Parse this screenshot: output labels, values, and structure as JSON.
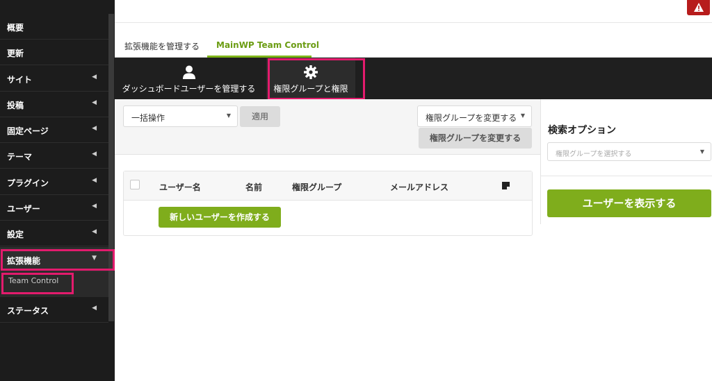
{
  "sidebar": {
    "items": [
      {
        "label": "概要",
        "has_caret": false
      },
      {
        "label": "更新",
        "has_caret": false
      },
      {
        "label": "サイト",
        "has_caret": true
      },
      {
        "label": "投稿",
        "has_caret": true
      },
      {
        "label": "固定ページ",
        "has_caret": true
      },
      {
        "label": "テーマ",
        "has_caret": true
      },
      {
        "label": "プラグイン",
        "has_caret": true
      },
      {
        "label": "ユーザー",
        "has_caret": true
      },
      {
        "label": "設定",
        "has_caret": true
      },
      {
        "label": "拡張機能",
        "has_caret": true,
        "expanded": true
      },
      {
        "label": "ステータス",
        "has_caret": true
      }
    ],
    "submenu": {
      "label": "Team Control"
    },
    "caret_glyph": "◀",
    "caret_down_glyph": "▼"
  },
  "topbar": {
    "alert_icon": "warning-icon",
    "alert_glyph": "!"
  },
  "tabs": [
    {
      "label": "拡張機能を管理する",
      "active": false
    },
    {
      "label": "MainWP Team Control",
      "active": true
    }
  ],
  "subnav": [
    {
      "label": "ダッシュボードユーザーを管理する",
      "icon": "user-icon"
    },
    {
      "label": "権限グループと権限",
      "icon": "gear-icon",
      "active": true
    }
  ],
  "toolbar": {
    "bulk_select": "一括操作",
    "apply_button": "適用",
    "group_select": "権限グループを変更する",
    "change_group_button": "権限グループを変更する"
  },
  "table": {
    "headers": [
      "ユーザー名",
      "名前",
      "権限グループ",
      "メールアドレス"
    ],
    "new_user_button": "新しいユーザーを作成する"
  },
  "search_panel": {
    "title": "検索オプション",
    "select_placeholder": "権限グループを選択する",
    "show_users_button": "ユーザーを表示する"
  },
  "colors": {
    "accent_green": "#7fad1c",
    "highlight_pink": "#e31b6d",
    "alert_red": "#b71c1c",
    "sidebar_bg": "#1c1c1c"
  }
}
